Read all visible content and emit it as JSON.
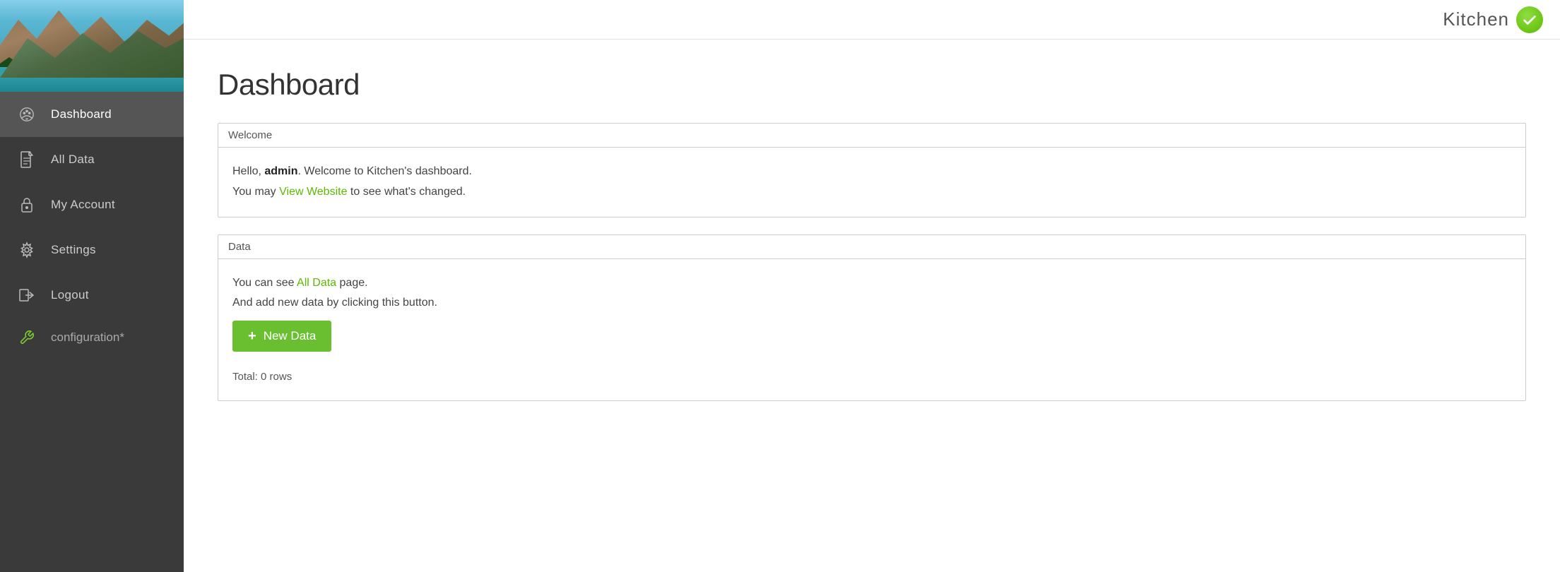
{
  "brand": {
    "name": "Kitchen",
    "icon_symbol": "✓"
  },
  "sidebar": {
    "nav_items": [
      {
        "id": "dashboard",
        "label": "Dashboard",
        "icon": "dashboard"
      },
      {
        "id": "all-data",
        "label": "All Data",
        "icon": "file"
      },
      {
        "id": "my-account",
        "label": "My Account",
        "icon": "lock"
      },
      {
        "id": "settings",
        "label": "Settings",
        "icon": "settings"
      },
      {
        "id": "logout",
        "label": "Logout",
        "icon": "logout"
      }
    ],
    "partial_item": {
      "label": "configuration*",
      "icon": "wrench"
    }
  },
  "page": {
    "title": "Dashboard"
  },
  "welcome_card": {
    "header": "Welcome",
    "greeting_prefix": "Hello, ",
    "user": "admin",
    "greeting_suffix": ". Welcome to Kitchen's dashboard.",
    "view_website_prefix": "You may ",
    "view_website_link": "View Website",
    "view_website_suffix": " to see what's changed."
  },
  "data_card": {
    "header": "Data",
    "description_prefix": "You can see ",
    "all_data_link": "All Data",
    "description_suffix": " page.",
    "add_description": "And add new data by clicking this button.",
    "button_label": "New Data",
    "button_plus": "+",
    "total_label": "Total: 0 rows"
  }
}
